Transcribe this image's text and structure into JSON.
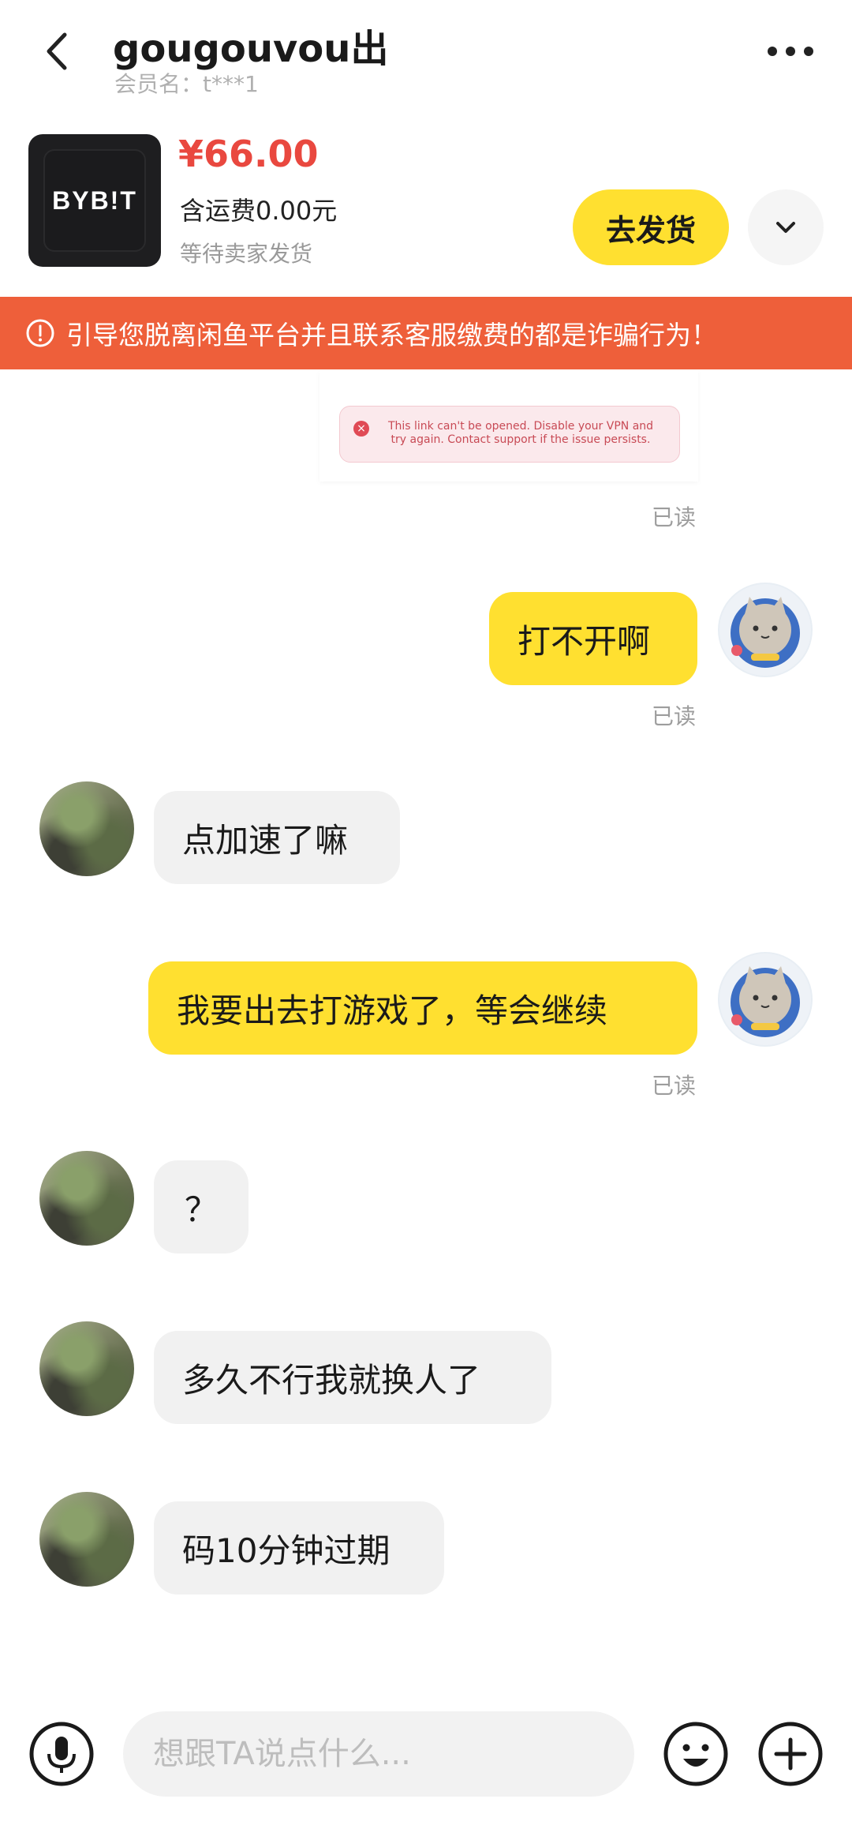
{
  "header": {
    "title": "gougouvou出",
    "subtitle": "会员名：t***1"
  },
  "product": {
    "thumbnail_text": "BYB!T",
    "price": "¥66.00",
    "shipping": "含运费0.00元",
    "status": "等待卖家发货",
    "ship_button": "去发货"
  },
  "warning": {
    "text": "引导您脱离闲鱼平台并且联系客服缴费的都是诈骗行为！"
  },
  "messages": {
    "image_error": "This link can't be opened. Disable your VPN and try again. Contact support if the issue persists.",
    "read_1": "已读",
    "msg_1": "打不开啊",
    "read_2": "已读",
    "msg_2": "点加速了嘛",
    "msg_3": "我要出去打游戏了，等会继续",
    "read_3": "已读",
    "msg_4": "？",
    "msg_5": "多久不行我就换人了",
    "msg_6": "码10分钟过期"
  },
  "input": {
    "placeholder": "想跟TA说点什么..."
  },
  "colors": {
    "accent_yellow": "#ffe030",
    "price_red": "#e9483f",
    "warning_orange": "#ee5f3a"
  },
  "icons": [
    "back-icon",
    "more-icon",
    "chevron-down-icon",
    "warning-icon",
    "mic-icon",
    "emoji-icon",
    "plus-icon"
  ]
}
